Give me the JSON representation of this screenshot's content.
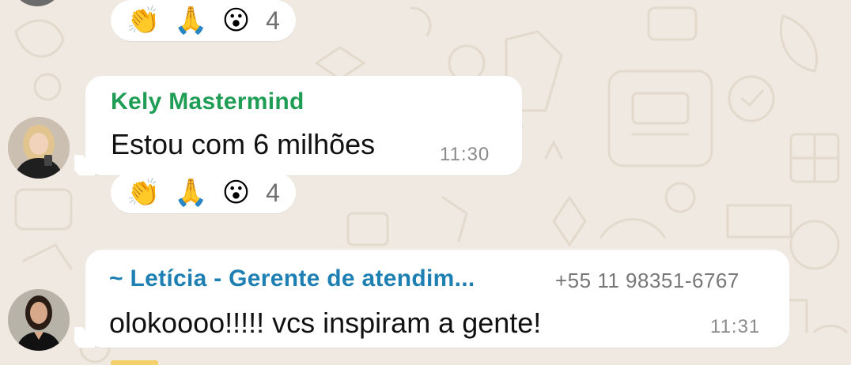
{
  "colors": {
    "background": "#efe9e1",
    "bubble": "#ffffff",
    "sender_kely": "#1f9d55",
    "sender_leticia": "#1e7fb3"
  },
  "reactions_top": {
    "emojis": [
      "👏",
      "🙏",
      "😮"
    ],
    "count": "4"
  },
  "messages": [
    {
      "sender": "Kely Mastermind",
      "text": "Estou com 6 milhões",
      "time": "11:30",
      "avatar": "avatar-kely",
      "reactions": {
        "emojis": [
          "👏",
          "🙏",
          "😮"
        ],
        "count": "4"
      }
    },
    {
      "sender": "~ Letícia - Gerente de atendim...",
      "phone": "+55 11 98351-6767",
      "text": "olokoooo!!!!!  vcs inspiram a gente!",
      "time": "11:31",
      "avatar": "avatar-leticia"
    }
  ]
}
